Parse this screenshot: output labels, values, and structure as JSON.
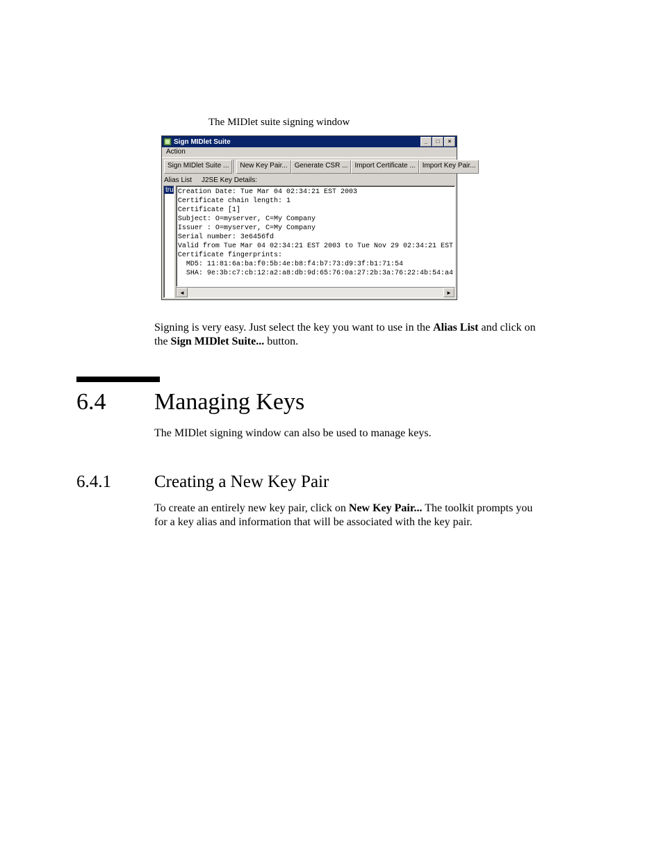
{
  "caption": "The MIDlet suite signing window",
  "window": {
    "title": "Sign MIDlet Suite",
    "menu": {
      "action": "Action"
    },
    "toolbar": {
      "sign": "Sign MIDlet Suite ...",
      "newkey": "New Key Pair...",
      "gencsr": "Generate CSR ...",
      "importcert": "Import Certificate ...",
      "importkey": "Import Key Pair..."
    },
    "labels": {
      "alias_list": "Alias List",
      "details": "J2SE Key Details:"
    },
    "alias_items": [
      "trustedkey"
    ],
    "details_lines": [
      "Creation Date: Tue Mar 04 02:34:21 EST 2003",
      "Certificate chain length: 1",
      "Certificate [1]",
      "Subject: O=myserver, C=My Company",
      "Issuer : O=myserver, C=My Company",
      "Serial number: 3e6456fd",
      "Valid from Tue Mar 04 02:34:21 EST 2003 to Tue Nov 29 02:34:21 EST",
      "Certificate fingerprints:",
      "  MD5: 11:81:6a:ba:f0:5b:4e:b8:f4:b7:73:d9:3f:b1:71:54",
      "  SHA: 9e:3b:c7:cb:12:a2:a8:db:9d:65:76:0a:27:2b:3a:76:22:4b:54:a4"
    ]
  },
  "paragraphs": {
    "signing_easy_pre": "Signing is very easy. Just select the key you want to use in the ",
    "signing_easy_bold1": "Alias List",
    "signing_easy_mid": " and click on the ",
    "signing_easy_bold2": "Sign MIDlet Suite...",
    "signing_easy_post": " button.",
    "managing_intro": "The MIDlet signing window can also be used to manage keys.",
    "newkey_pre": "To create an entirely new key pair, click on ",
    "newkey_bold": "New Key Pair...",
    "newkey_post": " The toolkit prompts you for a key alias and information that will be associated with the key pair."
  },
  "section": {
    "num": "6.4",
    "title": "Managing Keys"
  },
  "subsection": {
    "num": "6.4.1",
    "title": "Creating a New Key Pair"
  }
}
